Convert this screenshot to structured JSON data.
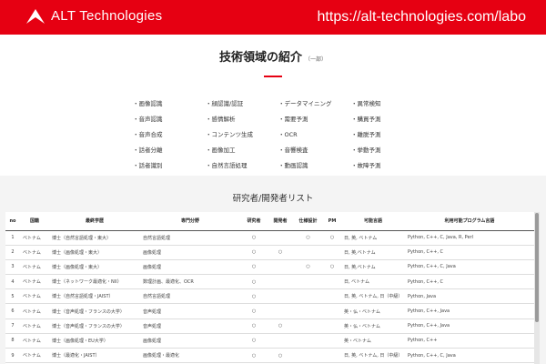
{
  "header": {
    "brand": "ALT Technologies",
    "url": "https://alt-technologies.com/labo",
    "bg_color": "#e60012"
  },
  "section": {
    "title": "技術領域の紹介",
    "subtitle": "（一部）",
    "accent_color": "#e60012"
  },
  "tech_items": [
    "・画像認識",
    "・顔認識/認証",
    "・データマイニング",
    "・異常検知",
    "・音声認識",
    "・感情解析",
    "・需要予測",
    "・購買予測",
    "・音声合成",
    "・コンテンツ生成",
    "・OCR",
    "・離脱予測",
    "・話者分離",
    "・画像加工",
    "・音響検査",
    "・挙動予測",
    "・話者識別",
    "・自然言語処理",
    "・動画認識",
    "・故障予測"
  ],
  "list": {
    "title": "研究者/開発者リスト",
    "columns": [
      "no",
      "国籍",
      "最終学歴",
      "専門分野",
      "研究者",
      "開発者",
      "仕様設計",
      "PM",
      "可能言語",
      "利用可能プログラム言語"
    ],
    "rows": [
      [
        "1",
        "ベトナム",
        "博士（自然言語処理・東大）",
        "自然言語処理",
        "○",
        "",
        "○",
        "○",
        "日, 英, ベトナム",
        "Python, C++, C, Java, R, Perl"
      ],
      [
        "2",
        "ベトナム",
        "博士（画像処理・東大）",
        "画像処理",
        "○",
        "○",
        "",
        "",
        "日, 英,ベトナム",
        "Python, C++, C"
      ],
      [
        "3",
        "ベトナム",
        "博士（画像処理・東大）",
        "画像処理",
        "○",
        "",
        "○",
        "○",
        "日, 英,ベトナム",
        "Python, C++, C, Java"
      ],
      [
        "4",
        "ベトナム",
        "博士（ネットワーク最適化・NII）",
        "数理計画、最適化、OCR",
        "○",
        "",
        "",
        "",
        "日, ベトナム",
        "Python, C++, C"
      ],
      [
        "5",
        "ベトナム",
        "博士（自然言語処理・JAIST）",
        "自然言語処理",
        "○",
        "",
        "",
        "",
        "日, 英, ベトナム, 日（中級）",
        "Python, Java"
      ],
      [
        "6",
        "ベトナム",
        "博士（音声処理・フランスの大学）",
        "音声処理",
        "○",
        "",
        "",
        "",
        "英・仏・ベトナム",
        "Python, C++, Java"
      ],
      [
        "7",
        "ベトナム",
        "博士（音声処理・フランスの大学）",
        "音声処理",
        "○",
        "○",
        "",
        "",
        "英・仏・ベトナム",
        "Python, C++, Java"
      ],
      [
        "8",
        "ベトナム",
        "博士（画像処理・EU大学）",
        "画像処理",
        "○",
        "",
        "",
        "",
        "英・ベトナム",
        "Python, C++"
      ],
      [
        "9",
        "ベトナム",
        "博士（最適化・JAIST）",
        "画像処理・最適化",
        "○",
        "○",
        "",
        "",
        "日, 英, ベトナム, 日（中級）",
        "Python, C++, C, Java"
      ]
    ]
  }
}
